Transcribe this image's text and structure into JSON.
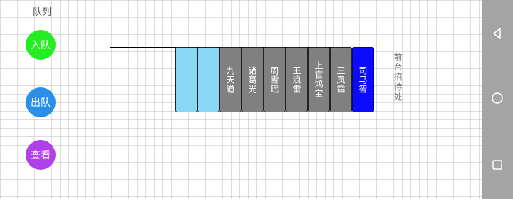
{
  "page": {
    "title": "队列"
  },
  "buttons": {
    "enqueue": {
      "label": "入队",
      "color": "#22ee22"
    },
    "dequeue": {
      "label": "出队",
      "color": "#2a8fe8"
    },
    "view": {
      "label": "查看",
      "color": "#b041e8"
    }
  },
  "queue": {
    "empty_slots": 2,
    "items": [
      "九天道",
      "诸葛光",
      "周雪瑶",
      "王浪雷",
      "上官鸿宝",
      "王凤霜"
    ],
    "head_item": "司马智",
    "colors": {
      "empty": "#88d8f5",
      "filled": "#808080",
      "head": "#0b0bff"
    }
  },
  "caption": "前台招待处",
  "navbar": {
    "icons": [
      "back-icon",
      "home-icon",
      "recent-apps-icon"
    ]
  }
}
